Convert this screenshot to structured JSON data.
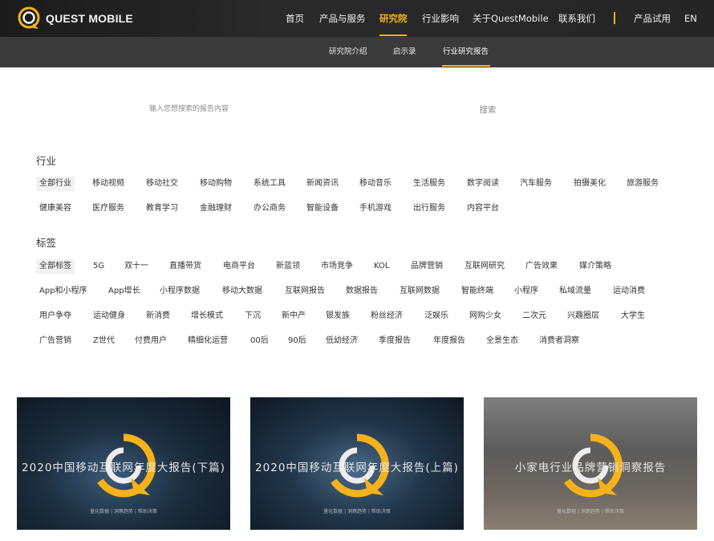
{
  "header": {
    "logo_text": "QUEST MOBILE",
    "nav": [
      "首页",
      "产品与服务",
      "研究院",
      "行业影响",
      "关于QuestMobile",
      "联系我们",
      "产品试用",
      "EN"
    ],
    "active_nav": "研究院",
    "accent_color": "#f6b21b"
  },
  "subnav": {
    "items": [
      "研究院介绍",
      "启示录",
      "行业研究报告"
    ],
    "active": "行业研究报告"
  },
  "search": {
    "placeholder": "输入您想搜索的报告内容",
    "button_label": "搜索"
  },
  "industry": {
    "title": "行业",
    "tags": [
      "全部行业",
      "移动视频",
      "移动社交",
      "移动购物",
      "系统工具",
      "新闻资讯",
      "移动音乐",
      "生活服务",
      "数字阅读",
      "汽车服务",
      "拍摄美化",
      "旅游服务",
      "健康美容",
      "医疗服务",
      "教育学习",
      "金融理财",
      "办公商务",
      "智能设备",
      "手机游戏",
      "出行服务",
      "内容平台"
    ]
  },
  "labels": {
    "title": "标签",
    "tags": [
      "全部标签",
      "5G",
      "双十一",
      "直播带货",
      "电商平台",
      "新蓝领",
      "市场竞争",
      "KOL",
      "品牌营销",
      "互联网研究",
      "广告效果",
      "媒介策略",
      "App和小程序",
      "App增长",
      "小程序数据",
      "移动大数据",
      "互联网报告",
      "数据报告",
      "互联网数据",
      "智能终端",
      "小程序",
      "私域流量",
      "运动消费",
      "用户争夺",
      "运动健身",
      "新消费",
      "增长模式",
      "下沉",
      "新中产",
      "银发族",
      "粉丝经济",
      "泛娱乐",
      "网购少女",
      "二次元",
      "兴趣圈层",
      "大学生",
      "广告营销",
      "Z世代",
      "付费用户",
      "精细化运营",
      "00后",
      "90后",
      "低幼经济",
      "季度报告",
      "年度报告",
      "全景生态",
      "消费者洞察"
    ]
  },
  "reports": [
    {
      "title": "2020中国移动互联网年度大报告(下篇)",
      "subtitle": "量化数据 | 洞察趋势 | 帮助决策"
    },
    {
      "title": "2020中国移动互联网年度大报告(上篇)",
      "subtitle": "量化数据 | 洞察趋势 | 帮助决策"
    },
    {
      "title": "小家电行业品牌营销洞察报告",
      "subtitle": "量化数据 | 洞察趋势 | 帮助决策"
    }
  ]
}
